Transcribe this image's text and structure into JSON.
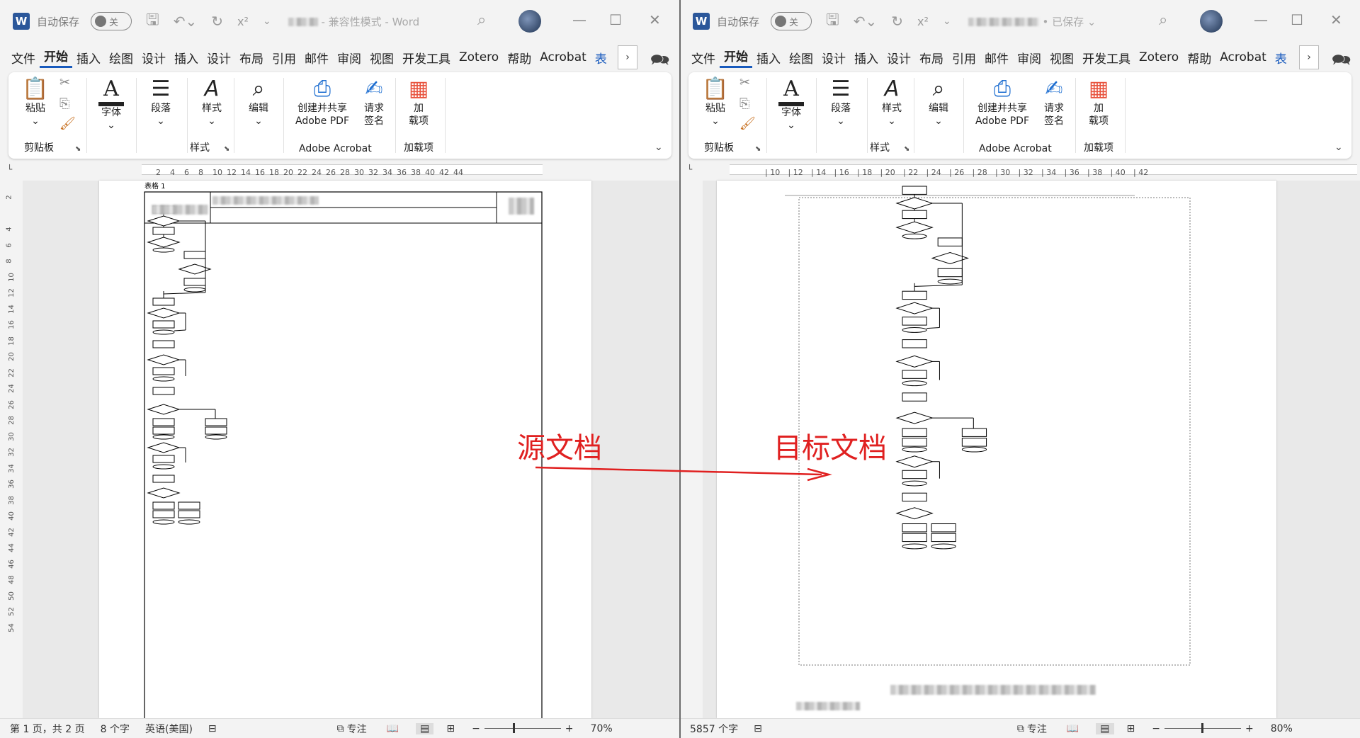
{
  "left": {
    "autosave_label": "自动保存",
    "autosave_state": "关",
    "title_suffix": "- 兼容性模式 - Word",
    "tabs": [
      "文件",
      "开始",
      "插入",
      "绘图",
      "设计",
      "插入",
      "设计",
      "布局",
      "引用",
      "邮件",
      "审阅",
      "视图",
      "开发工具",
      "Zotero",
      "帮助",
      "Acrobat",
      "表"
    ],
    "ruler_ticks": [
      "2",
      "4",
      "6",
      "8",
      "10",
      "12",
      "14",
      "16",
      "18",
      "20",
      "22",
      "24",
      "26",
      "28",
      "30",
      "32",
      "34",
      "36",
      "38",
      "40",
      "42",
      "44"
    ],
    "vruler_ticks": [
      "2",
      "",
      "4",
      "6",
      "8",
      "10",
      "12",
      "14",
      "16",
      "18",
      "20",
      "22",
      "24",
      "26",
      "28",
      "30",
      "32",
      "34",
      "36",
      "38",
      "40",
      "42",
      "44",
      "46",
      "48",
      "50",
      "52",
      "54"
    ],
    "table_caption": "表格 1",
    "status": {
      "pages": "第 1 页，共 2 页",
      "words": "8 个字",
      "language": "英语(美国)",
      "focus": "专注",
      "zoom": "70%"
    }
  },
  "right": {
    "autosave_label": "自动保存",
    "autosave_state": "关",
    "title_suffix": "• 已保存",
    "tabs": [
      "文件",
      "开始",
      "插入",
      "绘图",
      "设计",
      "插入",
      "设计",
      "布局",
      "引用",
      "邮件",
      "审阅",
      "视图",
      "开发工具",
      "Zotero",
      "帮助",
      "Acrobat",
      "表"
    ],
    "ruler_ticks": [
      "10",
      "12",
      "14",
      "16",
      "18",
      "20",
      "22",
      "24",
      "26",
      "28",
      "30",
      "32",
      "34",
      "36",
      "38",
      "40",
      "42"
    ],
    "status": {
      "words": "5857 个字",
      "focus": "专注",
      "zoom": "80%"
    }
  },
  "ribbon": {
    "paste": "粘贴",
    "clipboard_group": "剪贴板",
    "font": "字体",
    "paragraph": "段落",
    "styles": "样式",
    "styles_group": "样式",
    "editing": "编辑",
    "create_share_1": "创建并共享",
    "create_share_2": "Adobe PDF",
    "request_sign_1": "请求",
    "request_sign_2": "签名",
    "acrobat_group": "Adobe Acrobat",
    "addins_1": "加",
    "addins_2": "载项",
    "addins_group": "加载项"
  },
  "annotations": {
    "source": "源文档",
    "target": "目标文档",
    "color": "#e02020"
  },
  "colors": {
    "accent": "#185abd",
    "word_blue": "#2b579a",
    "addins_orange": "#e8543f"
  }
}
